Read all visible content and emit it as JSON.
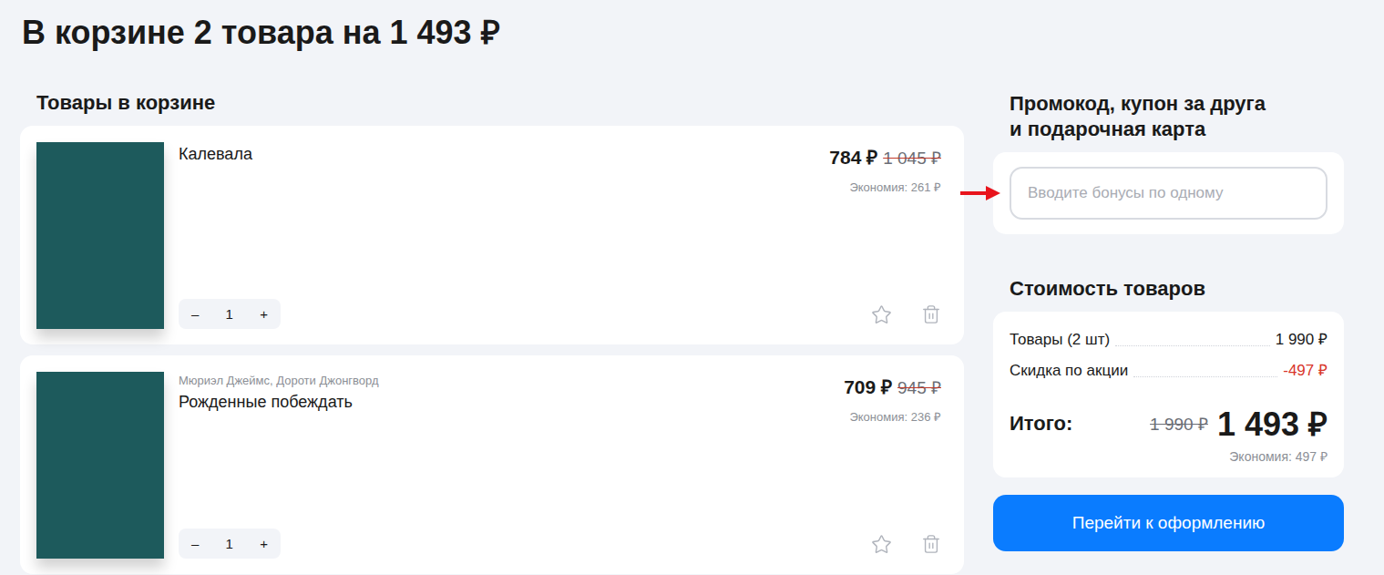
{
  "header": {
    "title": "В корзине 2 товара на 1 493 ₽"
  },
  "cart": {
    "heading": "Товары в корзине",
    "items": [
      {
        "author": "",
        "title": "Калевала",
        "price": "784 ₽",
        "old_price": "1 045 ₽",
        "saving": "Экономия: 261 ₽",
        "quantity": "1",
        "decrement": "–",
        "increment": "+",
        "favorite": false
      },
      {
        "author": "Мюриэл Джеймс, Дороти Джонгворд",
        "title": "Рожденные побеждать",
        "price": "709 ₽",
        "old_price": "945 ₽",
        "saving": "Экономия: 236 ₽",
        "quantity": "1",
        "decrement": "–",
        "increment": "+",
        "favorite": false
      }
    ]
  },
  "promo": {
    "heading_lines": [
      "Промокод, купон за друга",
      "и подарочная карта"
    ],
    "placeholder": "Вводите бонусы по одному"
  },
  "summary": {
    "heading": "Стоимость товаров",
    "rows": [
      {
        "label": "Товары (2 шт)",
        "value": "1 990 ₽",
        "kind": "plain"
      },
      {
        "label": "Скидка по акции",
        "value": "-497 ₽",
        "kind": "discount"
      }
    ],
    "total_label": "Итого:",
    "total_old": "1 990 ₽",
    "total": "1 493 ₽",
    "saving": "Экономия: 497 ₽"
  },
  "checkout_button": "Перейти к оформлению"
}
